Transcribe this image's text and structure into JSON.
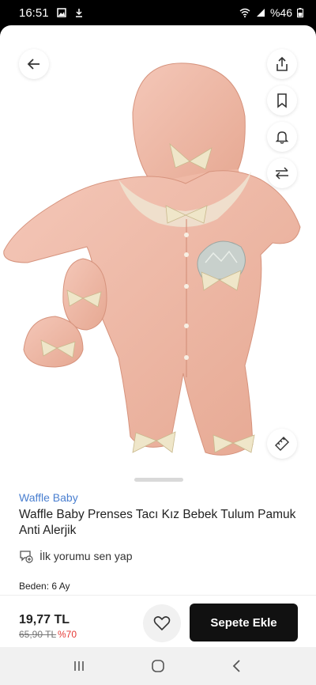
{
  "status_bar": {
    "time": "16:51",
    "battery": "%46"
  },
  "product": {
    "brand": "Waffle Baby",
    "title": "Waffle Baby Prenses Tacı Kız Bebek Tulum Pamuk Anti Alerjik",
    "review_prompt": "İlk yorumu sen yap",
    "size_label": "Beden: 6 Ay"
  },
  "purchase": {
    "price": "19,77 TL",
    "old_price": "65,90 TL",
    "discount": "%70",
    "add_to_cart_label": "Sepete Ekle"
  },
  "icons": {
    "back": "arrow-left-icon",
    "share": "share-icon",
    "bookmark": "bookmark-icon",
    "notify": "bell-icon",
    "compare": "swap-arrows-icon",
    "size_chart": "ruler-icon",
    "favorite": "heart-icon",
    "review": "add-comment-icon"
  },
  "colors": {
    "brand_link": "#4a7fd0",
    "discount": "#e53935",
    "cart_button": "#111111",
    "product_pink": "#eeb6a4"
  }
}
